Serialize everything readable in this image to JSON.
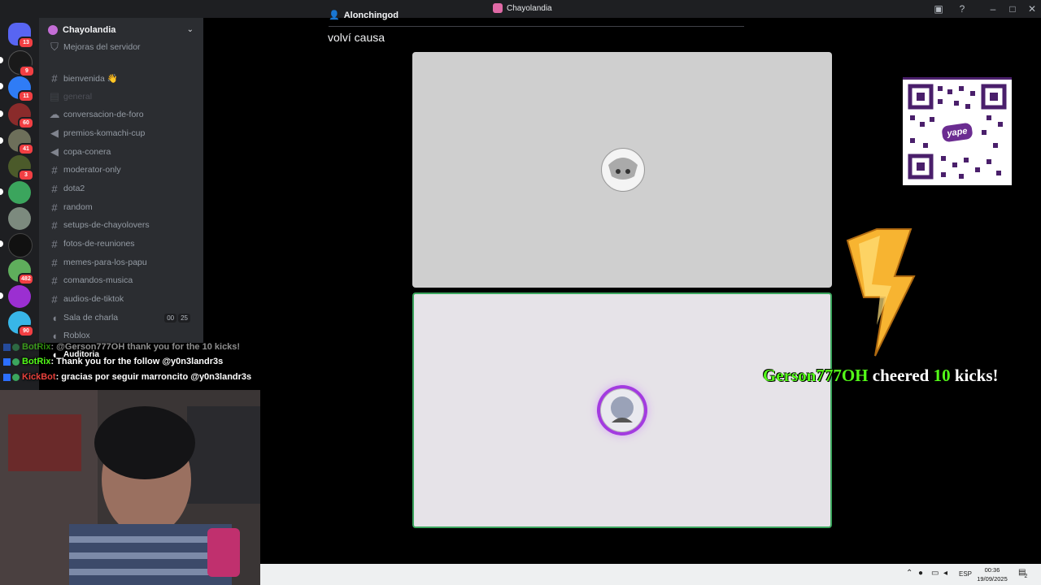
{
  "app": {
    "title": "Chayolandia"
  },
  "rail": {
    "badges": [
      "13",
      "9",
      "11",
      "60",
      "41",
      "3",
      "482",
      "90"
    ]
  },
  "sidebar": {
    "server_name": "Chayolandia",
    "items": [
      {
        "type": "boost",
        "label": "Mejoras del servidor"
      },
      {
        "type": "text",
        "label": "bienvenida 👋"
      },
      {
        "type": "text",
        "label": "general"
      },
      {
        "type": "forum",
        "label": "conversacion-de-foro"
      },
      {
        "type": "announce",
        "label": "premios-komachi-cup"
      },
      {
        "type": "announce",
        "label": "copa-conera"
      },
      {
        "type": "text",
        "label": "moderator-only"
      },
      {
        "type": "text",
        "label": "dota2"
      },
      {
        "type": "text",
        "label": "random"
      },
      {
        "type": "text",
        "label": "setups-de-chayolovers"
      },
      {
        "type": "text",
        "label": "fotos-de-reuniones"
      },
      {
        "type": "text",
        "label": "memes-para-los-papu"
      },
      {
        "type": "text",
        "label": "comandos-musica"
      },
      {
        "type": "text",
        "label": "audios-de-tiktok"
      },
      {
        "type": "voice",
        "label": "Sala de charla"
      },
      {
        "type": "voice",
        "label": "Roblox"
      },
      {
        "type": "voice",
        "label": "Auditoria"
      }
    ],
    "voice_counts": [
      "00",
      "25"
    ]
  },
  "chat": [
    {
      "user": "BotRix",
      "text": ": @Gerson777OH thank you for the 10 kicks!"
    },
    {
      "user": "BotRix",
      "text": ": Thank you for the follow @y0n3landr3s"
    },
    {
      "user": "KickBot",
      "text": ": gracias por seguir marroncito @y0n3landr3s"
    }
  ],
  "call": {
    "user": "Alonchingod",
    "title": "volví causa"
  },
  "qr": {
    "label": "yape"
  },
  "alert": {
    "name": "Gerson777OH",
    "verb": "cheered",
    "amount": "10",
    "unit": "kicks!"
  },
  "taskbar": {
    "lang": "ESP",
    "time": "00:36",
    "date": "19/09/2025",
    "notif": "2"
  },
  "colors": {
    "accent_green": "#53fc18",
    "discord_bg": "#2b2d31",
    "speaking_border": "#3ba55d"
  }
}
